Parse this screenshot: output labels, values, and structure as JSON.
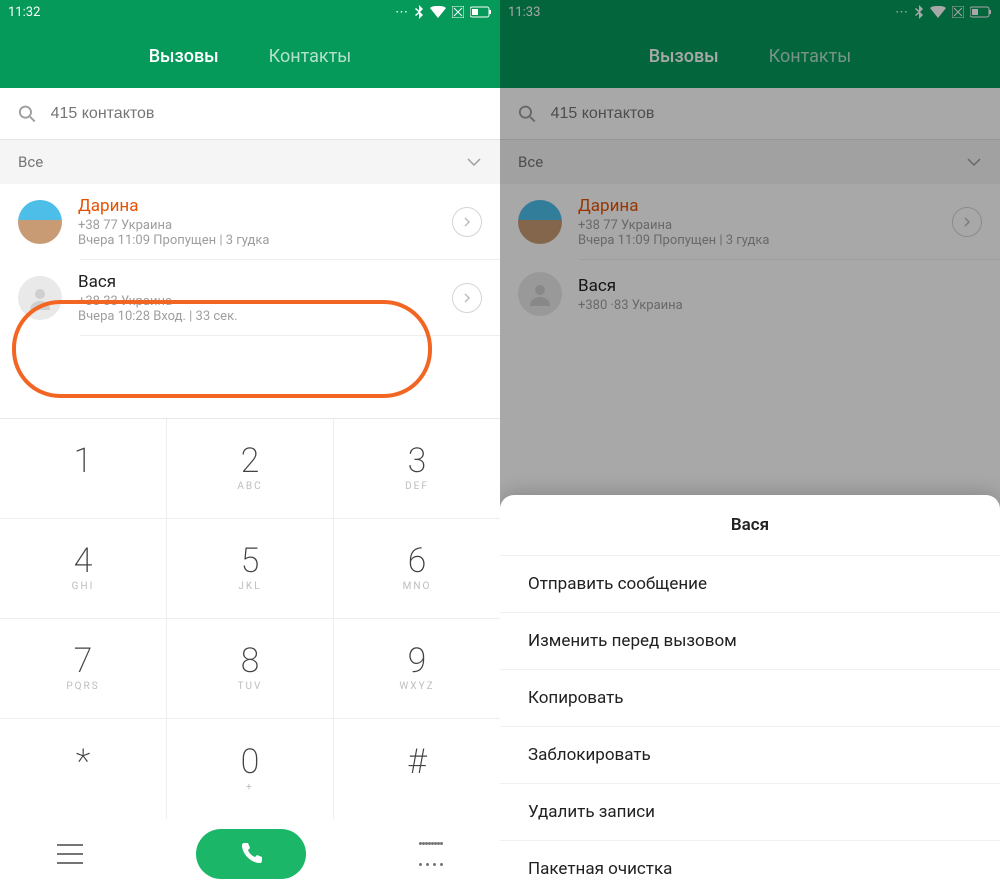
{
  "left": {
    "status": {
      "time": "11:32"
    },
    "tabs": {
      "calls": "Вызовы",
      "contacts": "Контакты"
    },
    "search": {
      "placeholder": "415 контактов"
    },
    "filter": {
      "label": "Все"
    },
    "calls": [
      {
        "name": "Дарина",
        "phone": "+38            77  Украина",
        "meta": "Вчера 11:09 Пропущен | 3 гудка",
        "missed": true
      },
      {
        "name": "Вася",
        "phone": "+38             33  Украина",
        "meta": "Вчера 10:28 Вход. | 33 сек.",
        "missed": false
      }
    ],
    "dialpad": [
      [
        {
          "n": "1",
          "l": ""
        },
        {
          "n": "2",
          "l": "ABC"
        },
        {
          "n": "3",
          "l": "DEF"
        }
      ],
      [
        {
          "n": "4",
          "l": "GHI"
        },
        {
          "n": "5",
          "l": "JKL"
        },
        {
          "n": "6",
          "l": "MNO"
        }
      ],
      [
        {
          "n": "7",
          "l": "PQRS"
        },
        {
          "n": "8",
          "l": "TUV"
        },
        {
          "n": "9",
          "l": "WXYZ"
        }
      ],
      [
        {
          "n": "*",
          "l": ""
        },
        {
          "n": "0",
          "l": "+"
        },
        {
          "n": "#",
          "l": ""
        }
      ]
    ]
  },
  "right": {
    "status": {
      "time": "11:33"
    },
    "tabs": {
      "calls": "Вызовы",
      "contacts": "Контакты"
    },
    "search": {
      "placeholder": "415 контактов"
    },
    "filter": {
      "label": "Все"
    },
    "calls": [
      {
        "name": "Дарина",
        "phone": "+38            77  Украина",
        "meta": "Вчера 11:09 Пропущен | 3 гудка",
        "missed": true
      },
      {
        "name": "Вася",
        "phone": "+380           ·83  Украина",
        "meta": "",
        "missed": false
      }
    ],
    "menu": {
      "title": "Вася",
      "items": [
        "Отправить сообщение",
        "Изменить перед вызовом",
        "Копировать",
        "Заблокировать",
        "Удалить записи",
        "Пакетная очистка"
      ]
    }
  }
}
